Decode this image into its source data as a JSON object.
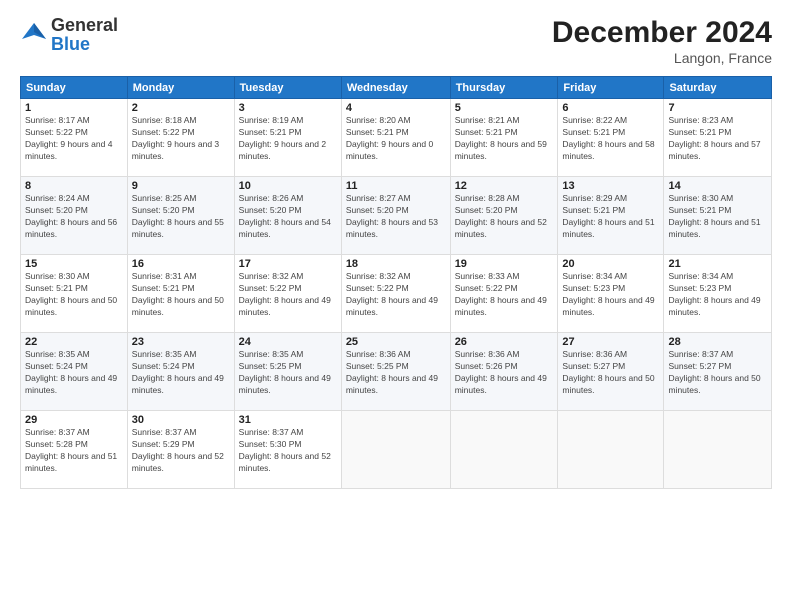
{
  "header": {
    "logo_general": "General",
    "logo_blue": "Blue",
    "title": "December 2024",
    "subtitle": "Langon, France"
  },
  "days_of_week": [
    "Sunday",
    "Monday",
    "Tuesday",
    "Wednesday",
    "Thursday",
    "Friday",
    "Saturday"
  ],
  "weeks": [
    [
      {
        "day": 1,
        "sunrise": "8:17 AM",
        "sunset": "5:22 PM",
        "daylight": "9 hours and 4 minutes."
      },
      {
        "day": 2,
        "sunrise": "8:18 AM",
        "sunset": "5:22 PM",
        "daylight": "9 hours and 3 minutes."
      },
      {
        "day": 3,
        "sunrise": "8:19 AM",
        "sunset": "5:21 PM",
        "daylight": "9 hours and 2 minutes."
      },
      {
        "day": 4,
        "sunrise": "8:20 AM",
        "sunset": "5:21 PM",
        "daylight": "9 hours and 0 minutes."
      },
      {
        "day": 5,
        "sunrise": "8:21 AM",
        "sunset": "5:21 PM",
        "daylight": "8 hours and 59 minutes."
      },
      {
        "day": 6,
        "sunrise": "8:22 AM",
        "sunset": "5:21 PM",
        "daylight": "8 hours and 58 minutes."
      },
      {
        "day": 7,
        "sunrise": "8:23 AM",
        "sunset": "5:21 PM",
        "daylight": "8 hours and 57 minutes."
      }
    ],
    [
      {
        "day": 8,
        "sunrise": "8:24 AM",
        "sunset": "5:20 PM",
        "daylight": "8 hours and 56 minutes."
      },
      {
        "day": 9,
        "sunrise": "8:25 AM",
        "sunset": "5:20 PM",
        "daylight": "8 hours and 55 minutes."
      },
      {
        "day": 10,
        "sunrise": "8:26 AM",
        "sunset": "5:20 PM",
        "daylight": "8 hours and 54 minutes."
      },
      {
        "day": 11,
        "sunrise": "8:27 AM",
        "sunset": "5:20 PM",
        "daylight": "8 hours and 53 minutes."
      },
      {
        "day": 12,
        "sunrise": "8:28 AM",
        "sunset": "5:20 PM",
        "daylight": "8 hours and 52 minutes."
      },
      {
        "day": 13,
        "sunrise": "8:29 AM",
        "sunset": "5:21 PM",
        "daylight": "8 hours and 51 minutes."
      },
      {
        "day": 14,
        "sunrise": "8:30 AM",
        "sunset": "5:21 PM",
        "daylight": "8 hours and 51 minutes."
      }
    ],
    [
      {
        "day": 15,
        "sunrise": "8:30 AM",
        "sunset": "5:21 PM",
        "daylight": "8 hours and 50 minutes."
      },
      {
        "day": 16,
        "sunrise": "8:31 AM",
        "sunset": "5:21 PM",
        "daylight": "8 hours and 50 minutes."
      },
      {
        "day": 17,
        "sunrise": "8:32 AM",
        "sunset": "5:22 PM",
        "daylight": "8 hours and 49 minutes."
      },
      {
        "day": 18,
        "sunrise": "8:32 AM",
        "sunset": "5:22 PM",
        "daylight": "8 hours and 49 minutes."
      },
      {
        "day": 19,
        "sunrise": "8:33 AM",
        "sunset": "5:22 PM",
        "daylight": "8 hours and 49 minutes."
      },
      {
        "day": 20,
        "sunrise": "8:34 AM",
        "sunset": "5:23 PM",
        "daylight": "8 hours and 49 minutes."
      },
      {
        "day": 21,
        "sunrise": "8:34 AM",
        "sunset": "5:23 PM",
        "daylight": "8 hours and 49 minutes."
      }
    ],
    [
      {
        "day": 22,
        "sunrise": "8:35 AM",
        "sunset": "5:24 PM",
        "daylight": "8 hours and 49 minutes."
      },
      {
        "day": 23,
        "sunrise": "8:35 AM",
        "sunset": "5:24 PM",
        "daylight": "8 hours and 49 minutes."
      },
      {
        "day": 24,
        "sunrise": "8:35 AM",
        "sunset": "5:25 PM",
        "daylight": "8 hours and 49 minutes."
      },
      {
        "day": 25,
        "sunrise": "8:36 AM",
        "sunset": "5:25 PM",
        "daylight": "8 hours and 49 minutes."
      },
      {
        "day": 26,
        "sunrise": "8:36 AM",
        "sunset": "5:26 PM",
        "daylight": "8 hours and 49 minutes."
      },
      {
        "day": 27,
        "sunrise": "8:36 AM",
        "sunset": "5:27 PM",
        "daylight": "8 hours and 50 minutes."
      },
      {
        "day": 28,
        "sunrise": "8:37 AM",
        "sunset": "5:27 PM",
        "daylight": "8 hours and 50 minutes."
      }
    ],
    [
      {
        "day": 29,
        "sunrise": "8:37 AM",
        "sunset": "5:28 PM",
        "daylight": "8 hours and 51 minutes."
      },
      {
        "day": 30,
        "sunrise": "8:37 AM",
        "sunset": "5:29 PM",
        "daylight": "8 hours and 52 minutes."
      },
      {
        "day": 31,
        "sunrise": "8:37 AM",
        "sunset": "5:30 PM",
        "daylight": "8 hours and 52 minutes."
      },
      null,
      null,
      null,
      null
    ]
  ]
}
